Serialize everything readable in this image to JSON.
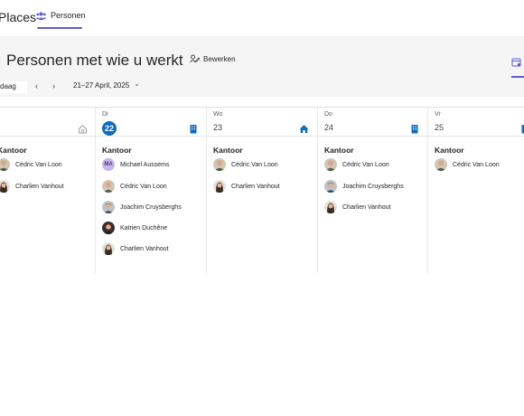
{
  "nav": {
    "app_title": "Places",
    "people_tab": "Personen"
  },
  "header": {
    "page_title": "Personen met wie u werkt",
    "edit_label": "Bewerken",
    "today_label": "daag",
    "prev_arrow": "‹",
    "next_arrow": "›",
    "date_range": "21–27 April, 2025",
    "date_dropdown": "⌄"
  },
  "days": [
    {
      "dow": "",
      "num": "",
      "location": "Kantoor",
      "people": [
        "Cédric Van Loon",
        "Charlien Vanhout"
      ]
    },
    {
      "dow": "Di",
      "num": "22",
      "location": "Kantoor",
      "people": [
        "Michael Aussems",
        "Cédric Van Loon",
        "Joachim Cruysberghs",
        "Katrien Duchêne",
        "Charlien Vanhout"
      ]
    },
    {
      "dow": "Wo",
      "num": "23",
      "location": "Kantoor",
      "people": [
        "Cédric Van Loon",
        "Charlien Vanhout"
      ]
    },
    {
      "dow": "Do",
      "num": "24",
      "location": "Kantoor",
      "people": [
        "Cédric Van Loon",
        "Joachim Cruysberghs",
        "Charlien Vanhout"
      ]
    },
    {
      "dow": "Vr",
      "num": "25",
      "location": "Kantoor",
      "people": [
        "Cédric Van Loon"
      ]
    }
  ],
  "avatar_initials": {
    "michael": "MA"
  },
  "colors": {
    "accent": "#5b5fc7",
    "today": "#0f6cbd",
    "icon_blue": "#0f6cbd"
  }
}
